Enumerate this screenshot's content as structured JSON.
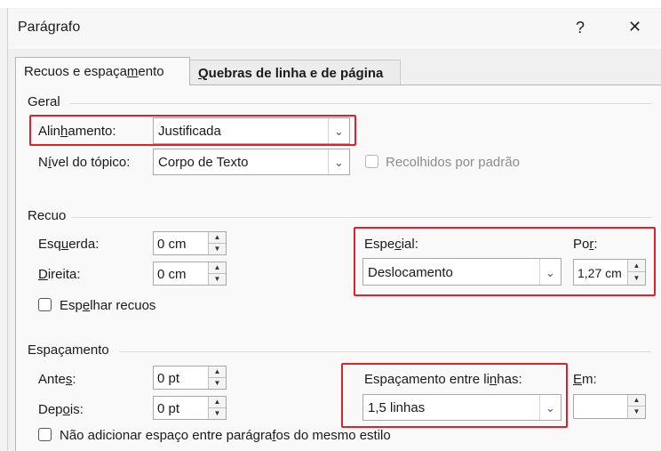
{
  "dialog": {
    "title": "Parágrafo",
    "help": "?",
    "close": "✕"
  },
  "tabs": [
    {
      "pre": "Recuos e espaça",
      "ul": "m",
      "post": "ento"
    },
    {
      "pre": "",
      "ul": "Q",
      "post": "uebras de linha e de página"
    }
  ],
  "geral": {
    "heading": "Geral",
    "alinhamento": {
      "pre": "Alin",
      "ul": "h",
      "post": "amento:",
      "value": "Justificada"
    },
    "nivel": {
      "pre": "N",
      "ul": "í",
      "post": "vel do tópico:",
      "value": "Corpo de Texto"
    },
    "recolhidos_label": "Recolhidos por padrão"
  },
  "recuo": {
    "heading": "Recuo",
    "esquerda": {
      "pre": "Esq",
      "ul": "u",
      "post": "erda:",
      "value": "0 cm"
    },
    "direita": {
      "pre": "",
      "ul": "D",
      "post": "ireita:",
      "value": "0 cm"
    },
    "espelhar": {
      "pre": "Esp",
      "ul": "e",
      "post": "lhar recuos"
    },
    "especial": {
      "pre": "Espe",
      "ul": "c",
      "post": "ial:",
      "value": "Deslocamento"
    },
    "por": {
      "pre": "Po",
      "ul": "r",
      "post": ":",
      "value": "1,27 cm"
    }
  },
  "espacamento": {
    "heading": "Espaçamento",
    "antes": {
      "pre": "Ante",
      "ul": "s",
      "post": ":",
      "value": "0 pt"
    },
    "depois": {
      "pre": "Dep",
      "ul": "o",
      "post": "is:",
      "value": "0 pt"
    },
    "entre": {
      "pre": "Espaçamento entre li",
      "ul": "n",
      "post": "has:",
      "value": "1,5 linhas"
    },
    "em": {
      "pre": "",
      "ul": "E",
      "post": "m:",
      "value": ""
    },
    "nao_adicionar": {
      "pre": "Não adicionar espaço entre parágra",
      "ul": "f",
      "post": "os do mesmo estilo"
    }
  },
  "colors": {
    "highlight": "#e0202b",
    "panel": "#f9f9f9"
  }
}
